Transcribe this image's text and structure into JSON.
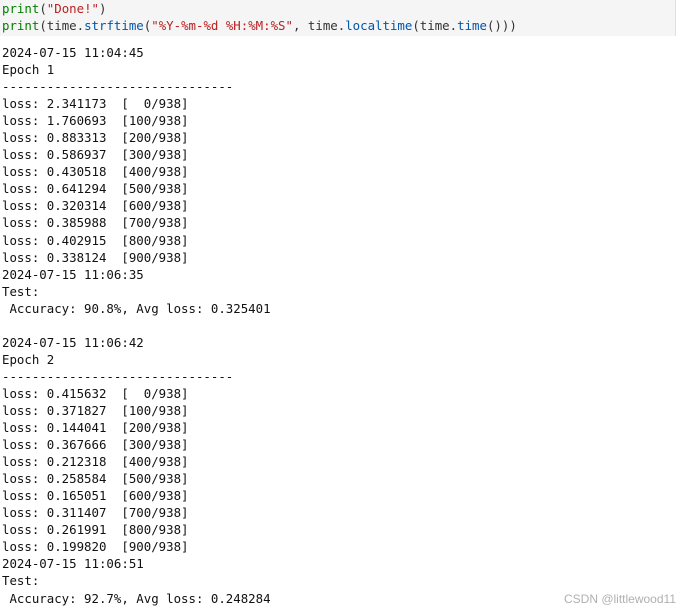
{
  "code": {
    "line1": {
      "fn": "print",
      "open": "(",
      "str": "\"Done!\"",
      "close": ")"
    },
    "line2": {
      "fn": "print",
      "open": "(time.",
      "fn2": "strftime",
      "open2": "(",
      "str": "\"%Y-%m-%d %H:%M:%S\"",
      "mid": ", time.",
      "fn3": "localtime",
      "mid2": "(time.",
      "fn4": "time",
      "close": "()))"
    }
  },
  "output_lines": [
    "2024-07-15 11:04:45",
    "Epoch 1",
    "-------------------------------",
    "loss: 2.341173  [  0/938]",
    "loss: 1.760693  [100/938]",
    "loss: 0.883313  [200/938]",
    "loss: 0.586937  [300/938]",
    "loss: 0.430518  [400/938]",
    "loss: 0.641294  [500/938]",
    "loss: 0.320314  [600/938]",
    "loss: 0.385988  [700/938]",
    "loss: 0.402915  [800/938]",
    "loss: 0.338124  [900/938]",
    "2024-07-15 11:06:35",
    "Test:",
    " Accuracy: 90.8%, Avg loss: 0.325401",
    "",
    "2024-07-15 11:06:42",
    "Epoch 2",
    "-------------------------------",
    "loss: 0.415632  [  0/938]",
    "loss: 0.371827  [100/938]",
    "loss: 0.144041  [200/938]",
    "loss: 0.367666  [300/938]",
    "loss: 0.212318  [400/938]",
    "loss: 0.258584  [500/938]",
    "loss: 0.165051  [600/938]",
    "loss: 0.311407  [700/938]",
    "loss: 0.261991  [800/938]",
    "loss: 0.199820  [900/938]",
    "2024-07-15 11:06:51",
    "Test:",
    " Accuracy: 92.7%, Avg loss: 0.248284"
  ],
  "watermark": "CSDN @littlewood11",
  "colors": {
    "cell_background": "#f5f5f5",
    "keyword": "#008000",
    "string": "#ba2121",
    "function": "#0055aa"
  }
}
